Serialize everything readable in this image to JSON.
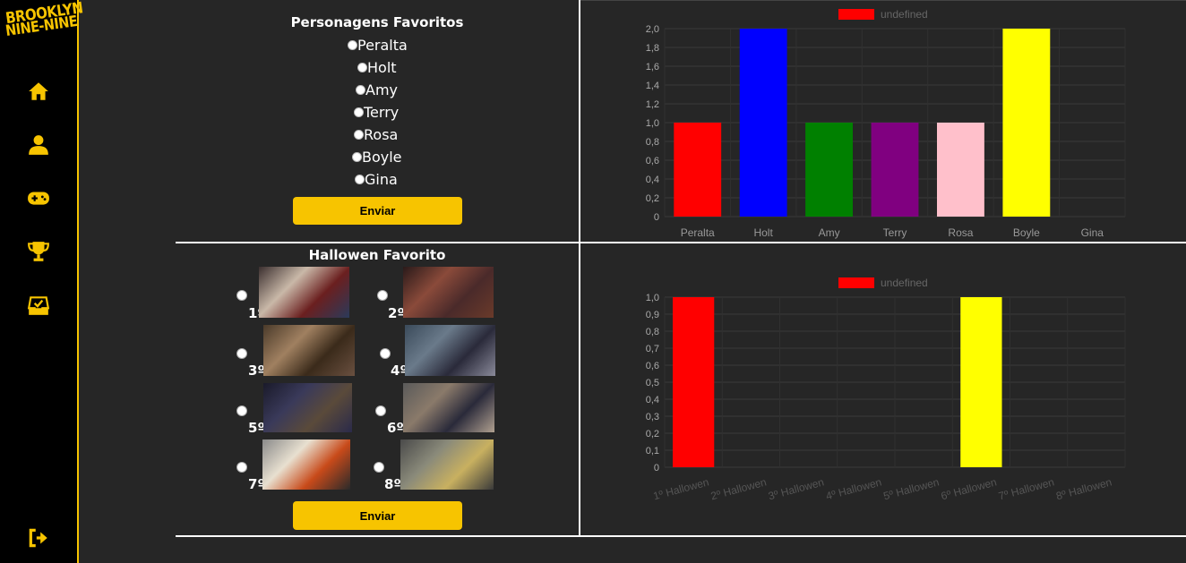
{
  "sidebar": {
    "logo_line1": "BROOKLYN",
    "logo_line2": "NINE-NINE",
    "items": [
      {
        "icon": "home-icon"
      },
      {
        "icon": "user-icon"
      },
      {
        "icon": "gamepad-icon"
      },
      {
        "icon": "trophy-icon"
      },
      {
        "icon": "inbox-icon"
      }
    ],
    "logout_icon": "logout-icon",
    "accent": "#f7c400"
  },
  "characters_form": {
    "title": "Personagens Favoritos",
    "options": [
      "Peralta",
      "Holt",
      "Amy",
      "Terry",
      "Rosa",
      "Boyle",
      "Gina"
    ],
    "submit_label": "Enviar"
  },
  "halloween_form": {
    "title": "Hallowen Favorito",
    "options": [
      "1º",
      "2º",
      "3º",
      "4º",
      "5º",
      "6º",
      "7º",
      "8º"
    ],
    "submit_label": "Enviar"
  },
  "chart_data": [
    {
      "type": "bar",
      "legend": "undefined",
      "categories": [
        "Peralta",
        "Holt",
        "Amy",
        "Terry",
        "Rosa",
        "Boyle",
        "Gina"
      ],
      "values": [
        1,
        2,
        1,
        1,
        1,
        2,
        0
      ],
      "colors": [
        "#ff0000",
        "#0000ff",
        "#008000",
        "#800080",
        "#ffc0cb",
        "#ffff00",
        "#888888"
      ],
      "ylim": [
        0,
        2.0
      ],
      "yticks": [
        "0",
        "0,2",
        "0,4",
        "0,6",
        "0,8",
        "1,0",
        "1,2",
        "1,4",
        "1,6",
        "1,8",
        "2,0"
      ]
    },
    {
      "type": "bar",
      "legend": "undefined",
      "categories": [
        "1º Hallowen",
        "2º Hallowen",
        "3º Hallowen",
        "4º Hallowen",
        "5º Hallowen",
        "6º Hallowen",
        "7º Hallowen",
        "8º Hallowen"
      ],
      "values": [
        1,
        0,
        0,
        0,
        0,
        1,
        0,
        0
      ],
      "colors": [
        "#ff0000",
        "#888888",
        "#888888",
        "#888888",
        "#888888",
        "#ffff00",
        "#888888",
        "#888888"
      ],
      "ylim": [
        0,
        1.0
      ],
      "yticks": [
        "0",
        "0,1",
        "0,2",
        "0,3",
        "0,4",
        "0,5",
        "0,6",
        "0,7",
        "0,8",
        "0,9",
        "1,0"
      ]
    }
  ]
}
